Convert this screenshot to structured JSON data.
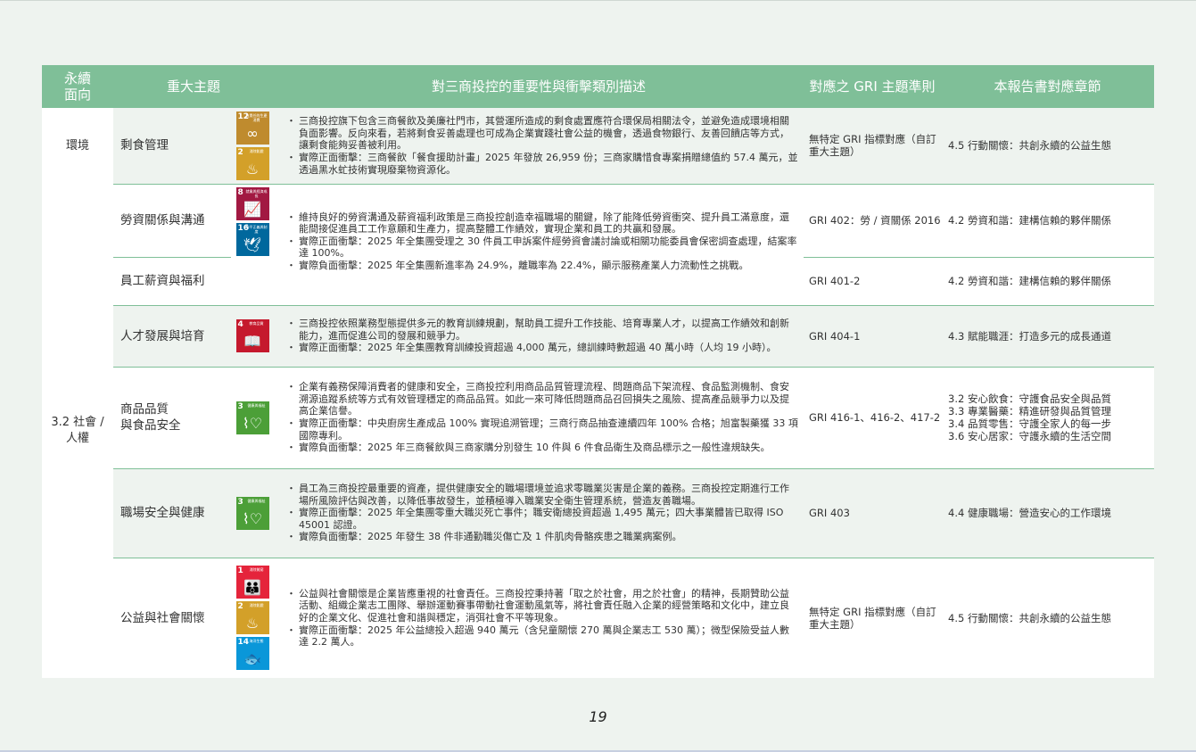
{
  "page_number": "19",
  "colors": {
    "header_bg": "#7fbf98",
    "row_alt_bg": "#eef3ef",
    "row_white_bg": "#ffffff",
    "divider": "#7fbf98",
    "page_bg": "#eef3ef"
  },
  "headers": {
    "dimension": "永續\n面向",
    "topic": "重大主題",
    "description": "對三商投控的重要性與衝擊類別描述",
    "gri": "對應之 GRI 主題準則",
    "section": "本報告書對應章節"
  },
  "dimensions": {
    "env": "環境",
    "social": "3.2 社會 /\n人權"
  },
  "rows": [
    {
      "topic": "剩食管理",
      "gri": "無特定 GRI 指標對應（自訂重大主題）",
      "section": "4.5 行動關懷：共創永續的公益生態",
      "desc": [
        "三商投控旗下包含三商餐飲及美廉社門市，其營運所造成的剩食處置應符合環保局相關法令，並避免造成環境相關負面影響。反向來看，若將剩食妥善處理也可成為企業實踐社會公益的機會，透過食物銀行、友善回饋店等方式，讓剩食能夠妥善被利用。",
        "實際正面衝擊：三商餐飲「餐食援助計畫」2025 年發放 26,959 份；三商家購惜食專案捐贈總值約 57.4 萬元，並透過黑水虻技術實現廢棄物資源化。"
      ]
    },
    {
      "topic": "勞資關係與溝通",
      "gri": "GRI 402：勞 / 資關係 2016",
      "section": "4.2 勞資和諧：建構信賴的夥伴關係"
    },
    {
      "topic": "員工薪資與福利",
      "gri": "GRI 401-2",
      "section": "4.2 勞資和諧：建構信賴的夥伴關係"
    },
    {
      "topic": "人才發展與培育",
      "gri": "GRI 404-1",
      "section": "4.3 賦能職涯：打造多元的成長通道",
      "desc": [
        "三商投控依照業務型態提供多元的教育訓練規劃，幫助員工提升工作技能、培育專業人才，以提高工作績效和創新能力，進而促進公司的發展和競爭力。",
        "實際正面衝擊：2025 年全集團教育訓練投資超過 4,000 萬元，總訓練時數超過 40 萬小時（人均 19 小時）。"
      ]
    },
    {
      "topic": "商品品質\n與食品安全",
      "gri": "GRI 416-1、416-2、417-2",
      "section": "3.2 安心飲食：守護食品安全與品質\n3.3 專業醫藥：精進研發與品質管理\n3.4 品質零售：守護全家人的每一步\n3.6 安心居家：守護永續的生活空間",
      "desc": [
        "企業有義務保障消費者的健康和安全，三商投控利用商品品質管理流程、問題商品下架流程、食品監測機制、食安溯源追蹤系統等方式有效管理穩定的商品品質。如此一來可降低問題商品召回損失之風險、提高產品競爭力以及提高企業信譽。",
        "實際正面衝擊：中央廚房生產成品 100% 實現追溯管理；三商行商品抽查連續四年 100% 合格；旭富製藥獲 33 項國際專利。",
        "實際負面衝擊：2025 年三商餐飲與三商家購分別發生 10 件與 6 件食品衛生及商品標示之一般性違規缺失。"
      ]
    },
    {
      "topic": "職場安全與健康",
      "gri": "GRI 403",
      "section": "4.4 健康職場：營造安心的工作環境",
      "desc": [
        "員工為三商投控最重要的資產，提供健康安全的職場環境並追求零職業災害是企業的義務。三商投控定期進行工作場所風險評估與改善，以降低事故發生，並積極導入職業安全衛生管理系統，營造友善職場。",
        "實際正面衝擊：2025 年全集團零重大職災死亡事件；職安衛總投資超過 1,495 萬元；四大事業體皆已取得 ISO 45001 認證。",
        "實際負面衝擊：2025 年發生 38 件非通勤職災傷亡及 1 件肌肉骨骼疾患之職業病案例。"
      ]
    },
    {
      "topic": "公益與社會關懷",
      "gri": "無特定 GRI 指標對應（自訂重大主題）",
      "section": "4.5 行動關懷：共創永續的公益生態",
      "desc": [
        "公益與社會關懷是企業皆應重視的社會責任。三商投控秉持著「取之於社會，用之於社會」的精神，長期贊助公益活動、組織企業志工團隊、舉辦運動賽事帶動社會運動風氣等，將社會責任融入企業的經營策略和文化中，建立良好的企業文化、促進社會和諧與穩定，消弭社會不平等現象。",
        "實際正面衝擊：2025 年公益總投入超過 940 萬元（含兒童關懷 270 萬與企業志工 530 萬）；微型保險受益人數達 2.2 萬人。"
      ]
    }
  ],
  "labor_desc": [
    "維持良好的勞資溝通及薪資福利政策是三商投控創造幸福職場的關鍵，除了能降低勞資衝突、提升員工滿意度，還能間接促進員工工作意願和生產力，提高整體工作績效，實現企業和員工的共贏和發展。",
    "實際正面衝擊：2025 年全集團受理之 30 件員工申訴案件經勞資會議討論或相關功能委員會保密調查處理，結案率達 100%。",
    "實際負面衝擊：2025 年全集團新進率為 24.9%，離職率為 22.4%，顯示服務產業人力流動性之挑戰。"
  ],
  "sdg": {
    "12": {
      "num": "12",
      "label": "負責任的生產消費",
      "color": "#bf8b2e",
      "glyph": "∞"
    },
    "2": {
      "num": "2",
      "label": "消除飢餓",
      "color": "#d3a029",
      "glyph": "♨"
    },
    "8": {
      "num": "8",
      "label": "就業與經濟成長",
      "color": "#a21942",
      "glyph": "📈"
    },
    "16": {
      "num": "16",
      "label": "和平正義與制度",
      "color": "#00689d",
      "glyph": "🕊"
    },
    "4": {
      "num": "4",
      "label": "教育品質",
      "color": "#c5192d",
      "glyph": "📖"
    },
    "3": {
      "num": "3",
      "label": "健康與福祉",
      "color": "#4c9f38",
      "glyph": "⌇♡"
    },
    "1": {
      "num": "1",
      "label": "消除貧窮",
      "color": "#e5243b",
      "glyph": "👪"
    },
    "14": {
      "num": "14",
      "label": "海洋生態",
      "color": "#0a97d9",
      "glyph": "🐟"
    }
  }
}
